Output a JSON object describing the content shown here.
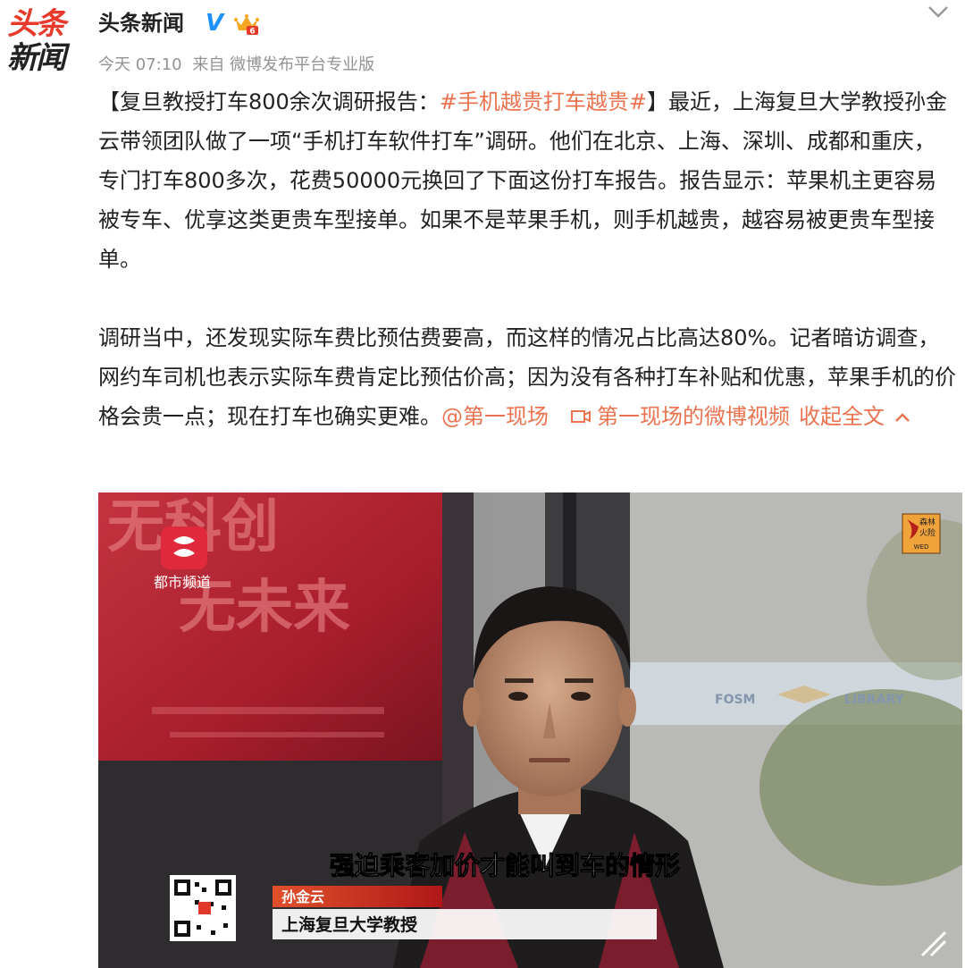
{
  "header": {
    "logo_top": "头条",
    "logo_bottom": "新闻",
    "username": "头条新闻",
    "verified_mark": "V",
    "vip_badge_level": "6"
  },
  "meta": {
    "time": "今天 07:10",
    "source": "来自 微博发布平台专业版"
  },
  "post": {
    "p1_bracket_open": "【复旦教授打车800余次调研报告：",
    "p1_hashtag": "#手机越贵打车越贵#",
    "p1_rest": "】最近，上海复旦大学教授孙金云带领团队做了一项“手机打车软件打车”调研。他们在北京、上海、深圳、成都和重庆，专门打车800多次，花费50000元换回了下面这份打车报告。报告显示：苹果机主更容易被专车、优享这类更贵车型接单。如果不是苹果手机，则手机越贵，越容易被更贵车型接单。",
    "p2_text": "调研当中，还发现实际车费比预估费要高，而这样的情况占比高达80%。记者暗访调查，网约车司机也表示实际车费肯定比预估价高；因为没有各种打车补贴和优惠，苹果手机的价格会贵一点；现在打车也确实更难。",
    "mention": "@第一现场",
    "video_link": "第一现场的微博视频",
    "collapse": "收起全文"
  },
  "video": {
    "bg_text_1": "无科创",
    "bg_text_2": "无未来",
    "channel": "都市频道",
    "library_sign_left": "FOSM",
    "library_sign_right": "LIBRARY",
    "corner_badge_top": "森林",
    "corner_badge_mid": "火险",
    "corner_badge_bottom": "WED",
    "subtitle": "强迫乘客加价才能叫到车的情形",
    "name_tag": "孙金云",
    "title_tag": "上海复旦大学教授"
  },
  "colors": {
    "link": "#eb7350",
    "brand_red": "#e8392a",
    "verified_blue": "#1e90ff",
    "meta_gray": "#939393"
  },
  "icons": {
    "chevron": "chevron-down-icon",
    "video_link": "video-camera-icon",
    "collapse": "chevron-up-icon",
    "expand": "expand-icon"
  }
}
